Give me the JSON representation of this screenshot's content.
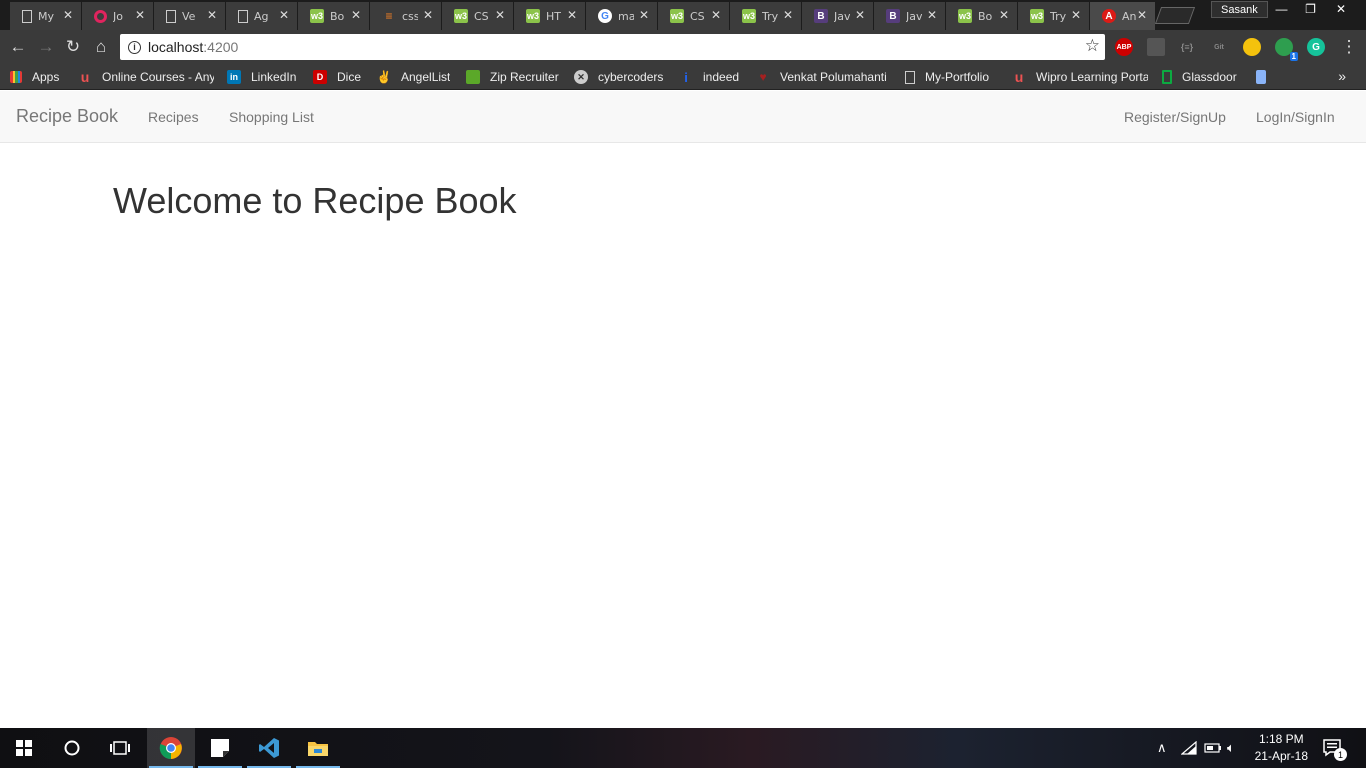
{
  "browser": {
    "tabs": [
      {
        "title": "My",
        "icon": "page-icon"
      },
      {
        "title": "Jo",
        "icon": "red-circle-icon"
      },
      {
        "title": "Ve",
        "icon": "page-icon"
      },
      {
        "title": "Ag",
        "icon": "page-icon"
      },
      {
        "title": "Bo",
        "icon": "w3-icon"
      },
      {
        "title": "css",
        "icon": "stackoverflow-icon"
      },
      {
        "title": "CS",
        "icon": "w3-icon"
      },
      {
        "title": "HT",
        "icon": "w3-icon"
      },
      {
        "title": "ma",
        "icon": "google-icon"
      },
      {
        "title": "CS",
        "icon": "w3-icon"
      },
      {
        "title": "Try",
        "icon": "w3-icon"
      },
      {
        "title": "Jav",
        "icon": "bootstrap-icon"
      },
      {
        "title": "Jav",
        "icon": "bootstrap-icon"
      },
      {
        "title": "Bo",
        "icon": "w3-icon"
      },
      {
        "title": "Try",
        "icon": "w3-icon"
      },
      {
        "title": "An",
        "icon": "angular-icon"
      }
    ],
    "profile": "Sasank",
    "url": {
      "host": "localhost",
      "port": ":4200"
    },
    "bookmarks": [
      {
        "label": "Apps",
        "icon": "apps-grid-icon"
      },
      {
        "label": "Online Courses - Any",
        "icon": "udemy-icon"
      },
      {
        "label": "LinkedIn",
        "icon": "linkedin-icon"
      },
      {
        "label": "Dice",
        "icon": "dice-icon"
      },
      {
        "label": "AngelList",
        "icon": "angellist-icon"
      },
      {
        "label": "Zip Recruiter",
        "icon": "ziprecruiter-icon"
      },
      {
        "label": "cybercoders",
        "icon": "cybercoders-icon"
      },
      {
        "label": "indeed",
        "icon": "indeed-icon"
      },
      {
        "label": "Venkat Polumahanti",
        "icon": "portfolio-icon"
      },
      {
        "label": "My-Portfolio",
        "icon": "page-icon"
      },
      {
        "label": "Wipro Learning Porta",
        "icon": "udemy-icon"
      },
      {
        "label": "Glassdoor",
        "icon": "glassdoor-icon"
      }
    ],
    "extensions": {
      "abp": "ABP",
      "badge": "1"
    }
  },
  "page": {
    "brand": "Recipe Book",
    "nav_left": [
      "Recipes",
      "Shopping List"
    ],
    "nav_right": [
      "Register/SignUp",
      "LogIn/SignIn"
    ],
    "heading": "Welcome to Recipe Book"
  },
  "taskbar": {
    "time": "1:18 PM",
    "date": "21-Apr-18",
    "notifications": "1"
  },
  "colors": {
    "navbar_bg": "#f8f8f8",
    "nav_text": "#777777",
    "heading_text": "#333333",
    "taskbar_accent": "#76b9ed"
  }
}
